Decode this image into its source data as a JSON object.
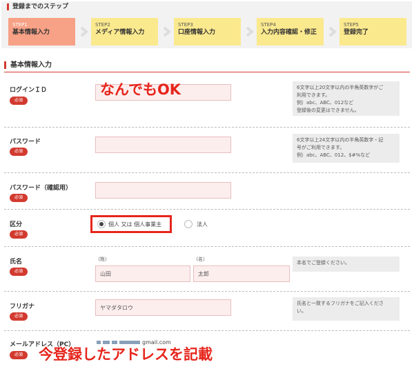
{
  "steps": {
    "title": "登録までのステップ",
    "items": [
      {
        "num": "STEP1",
        "label": "基本情報入力"
      },
      {
        "num": "STEP2",
        "label": "メディア情報入力"
      },
      {
        "num": "STEP3",
        "label": "口座情報入力"
      },
      {
        "num": "STEP4",
        "label": "入力内容確認・修正"
      },
      {
        "num": "STEP5",
        "label": "登録完了"
      }
    ]
  },
  "section": {
    "title": "基本情報入力"
  },
  "required_label": "必須",
  "fields": {
    "login_id": {
      "label": "ログインＩＤ",
      "value": "",
      "help": [
        "6文字以上20文字以内の半角英数字がご",
        "利用できます。",
        "例）abc、ABC、012など",
        "登録後の変更はできません。"
      ]
    },
    "password": {
      "label": "パスワード",
      "value": "",
      "help": [
        "6文字以上24文字以内の半角英数字・記",
        "号がご利用できます。",
        "例）abc、ABC、012、$#%など"
      ]
    },
    "password_confirm": {
      "label": "パスワード（確認用）",
      "value": ""
    },
    "division": {
      "label": "区分",
      "options": [
        "個人 又は 個人事業主",
        "法人"
      ],
      "selected": "個人 又は 個人事業主"
    },
    "name": {
      "label": "氏名",
      "last_label": "（姓）",
      "first_label": "（名）",
      "last_value": "山田",
      "first_value": "太郎",
      "help": [
        "本名でご登録ください。"
      ]
    },
    "furigana": {
      "label": "フリガナ",
      "value": "ヤマダタロウ",
      "help": [
        "氏名と一致するフリガナをご記入くださ",
        "い。"
      ]
    },
    "email": {
      "label": "メールアドレス（PC）",
      "value_suffix": "gmail.com"
    }
  },
  "annotations": {
    "top": "なんでもOK",
    "bottom": "今登録したアドレスを記載"
  },
  "colors": {
    "accent": "#d23a2f",
    "step_active": "#f7a186",
    "step": "#fbe98e",
    "input_bg": "#fdeeee",
    "annotation": "#e6251b"
  }
}
